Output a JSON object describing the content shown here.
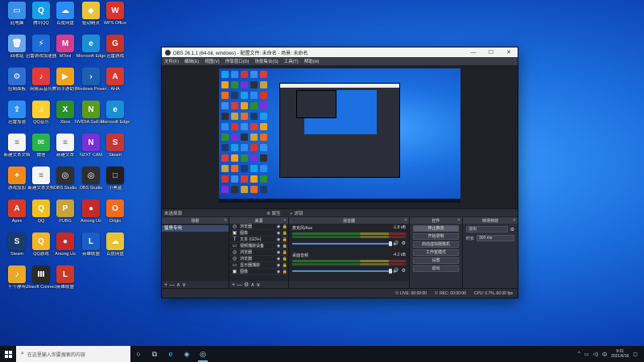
{
  "desktop": {
    "icons": [
      {
        "label": "此电脑",
        "color": "#3a8ee6",
        "glyph": "▭"
      },
      {
        "label": "腾讯QQ",
        "color": "#16a0e8",
        "glyph": "Q"
      },
      {
        "label": "百度网盘",
        "color": "#2a8bf2",
        "glyph": "☁"
      },
      {
        "label": "驱动精灵",
        "color": "#e8c33a",
        "glyph": "◆"
      },
      {
        "label": "WPS Office",
        "color": "#d8342d",
        "glyph": "W"
      },
      {
        "label": "回收站",
        "color": "#6aa7e8",
        "glyph": "🗑"
      },
      {
        "label": "迅雷游戏加速器",
        "color": "#1c6cd8",
        "glyph": "⚡"
      },
      {
        "label": "MTool",
        "color": "#d53b8e",
        "glyph": "M"
      },
      {
        "label": "Microsoft Edge",
        "color": "#1b8fd6",
        "glyph": "e"
      },
      {
        "label": "迅雷游戏",
        "color": "#c7332a",
        "glyph": "G"
      },
      {
        "label": "控制面板",
        "color": "#2e6fd6",
        "glyph": "⚙"
      },
      {
        "label": "网易云音乐",
        "color": "#e03a3a",
        "glyph": "♪"
      },
      {
        "label": "腾讯手游助手",
        "color": "#f0a21a",
        "glyph": "▶"
      },
      {
        "label": "Windows PowerShell",
        "color": "#1e5fb3",
        "glyph": "›"
      },
      {
        "label": "AHA",
        "color": "#d8392e",
        "glyph": "A"
      },
      {
        "label": "迅雷加速",
        "color": "#2c8ef0",
        "glyph": "⇪"
      },
      {
        "label": "QQ音乐",
        "color": "#ffd02b",
        "glyph": "♫"
      },
      {
        "label": "Xbox",
        "color": "#2b8f2b",
        "glyph": "X"
      },
      {
        "label": "NVIDIA GeForce Experience",
        "color": "#5a9b1a",
        "glyph": "N"
      },
      {
        "label": "Microsoft Edge",
        "color": "#1b8fd6",
        "glyph": "e"
      },
      {
        "label": "新建文本文档",
        "color": "#f5f5f5",
        "glyph": "≡"
      },
      {
        "label": "微信",
        "color": "#2ab34a",
        "glyph": "✉"
      },
      {
        "label": "新建文本",
        "color": "#f5f5f5",
        "glyph": "≡"
      },
      {
        "label": "NZXT CAM",
        "color": "#7b2fd6",
        "glyph": "N"
      },
      {
        "label": "Steam",
        "color": "#c93535",
        "glyph": "S"
      },
      {
        "label": "游戏加加",
        "color": "#f28a1a",
        "glyph": "+"
      },
      {
        "label": "新建文本文档",
        "color": "#f5f5f5",
        "glyph": "≡"
      },
      {
        "label": "OBS Studio",
        "color": "#303030",
        "glyph": "◎"
      },
      {
        "label": "OBS Studio",
        "color": "#303030",
        "glyph": "◎"
      },
      {
        "label": "小黑盒",
        "color": "#202020",
        "glyph": "□"
      },
      {
        "label": "Apex",
        "color": "#d83a2a",
        "glyph": "A"
      },
      {
        "label": "QQ",
        "color": "#f0c020",
        "glyph": "Q"
      },
      {
        "label": "PUBG",
        "color": "#c8a23a",
        "glyph": "P"
      },
      {
        "label": "Among Us",
        "color": "#c42a2a",
        "glyph": "●"
      },
      {
        "label": "Origin",
        "color": "#f26b1a",
        "glyph": "O"
      },
      {
        "label": "Steam",
        "color": "#1b3b6f",
        "glyph": "S"
      },
      {
        "label": "QQ游戏",
        "color": "#f2b42a",
        "glyph": "Q"
      },
      {
        "label": "Among Us",
        "color": "#c42a2a",
        "glyph": "●"
      },
      {
        "label": "英雄联盟",
        "color": "#1a5ec8",
        "glyph": "L"
      },
      {
        "label": "百度网盘",
        "color": "#e8c33a",
        "glyph": "☁"
      },
      {
        "label": "千千静听",
        "color": "#e8a92a",
        "glyph": "♪"
      },
      {
        "label": "Ubisoft Connect",
        "color": "#2a2a2a",
        "glyph": "Ⅲ"
      },
      {
        "label": "英雄联盟",
        "color": "#c83a2a",
        "glyph": "L"
      }
    ]
  },
  "obs": {
    "title": "OBS 26.1.1 (64-bit, windows) - 配置文件: 未命名 - 场景: 未命名",
    "win_min": "—",
    "win_max": "☐",
    "win_close": "✕",
    "menu": [
      "文件(F)",
      "编辑(E)",
      "视图(V)",
      "停靠窗口(D)",
      "场景集合(S)",
      "工具(T)",
      "帮助(H)"
    ],
    "scene_bar": {
      "no_scene": "未选择源",
      "properties": "⚙ 属性",
      "filters": "◐ 滤镜"
    },
    "docks": {
      "scenes": {
        "title": "场景",
        "items": [
          "猛男专用"
        ],
        "foot": "+ — ∧ ∨"
      },
      "sources": {
        "title": "来源",
        "items": [
          {
            "icon": "◎",
            "name": "浏览器"
          },
          {
            "icon": "▣",
            "name": "图像"
          },
          {
            "icon": "T",
            "name": "文本 (GDI+)"
          },
          {
            "icon": "▭",
            "name": "视频捕获设备"
          },
          {
            "icon": "◎",
            "name": "浏览器"
          },
          {
            "icon": "◎",
            "name": "浏览器"
          },
          {
            "icon": "▭",
            "name": "显示器捕获"
          },
          {
            "icon": "▣",
            "name": "图像"
          }
        ],
        "foot": "+ — ⚙ ∧ ∨"
      },
      "mixer": {
        "title": "混音器",
        "channels": [
          {
            "name": "麦克风/Aux",
            "db": "-1.8 dB"
          },
          {
            "name": "桌面音频",
            "db": "-4.2 dB"
          }
        ]
      },
      "controls": {
        "title": "控件",
        "buttons": [
          "停止推流",
          "开始录制",
          "启动虚拟摄像机",
          "工作室模式",
          "设置",
          "退出"
        ]
      },
      "transitions": {
        "title": "转场特效",
        "transition": "淡出",
        "duration_label": "时长",
        "duration": "300 ms"
      }
    },
    "status": {
      "live": "LIVE: 00:00:00",
      "rec": "REC: 00:00:00",
      "cpu": "CPU: 0.7%, 60.00 fps"
    }
  },
  "taskbar": {
    "search_placeholder": "在这里输入你要搜索的内容",
    "time": "9:01",
    "date": "2021/6/16",
    "lang": "中"
  }
}
